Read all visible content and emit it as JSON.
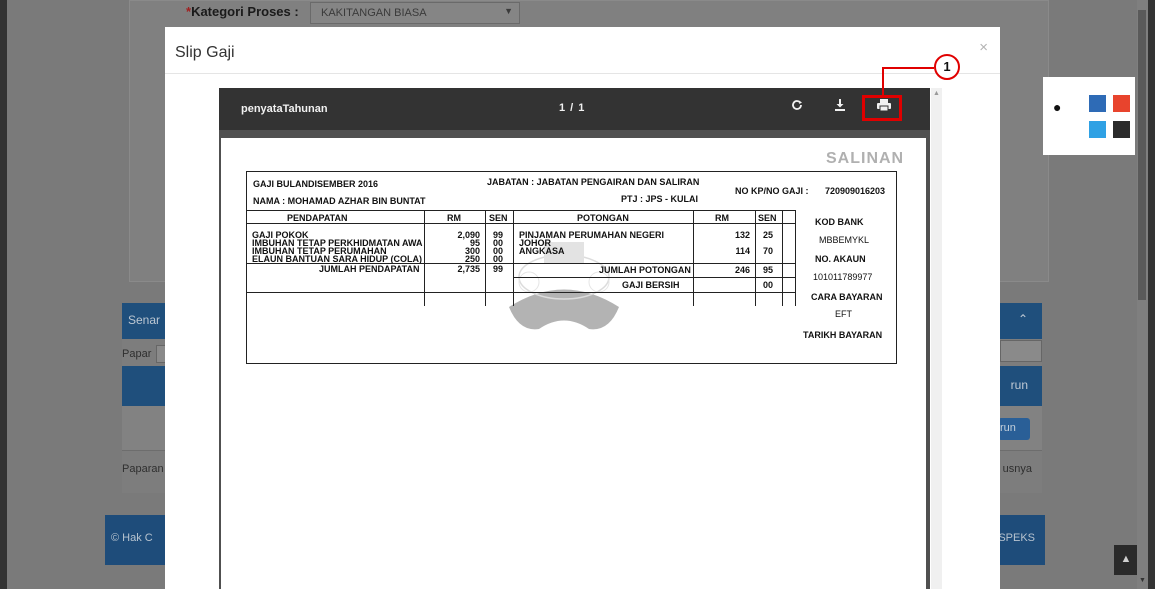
{
  "background": {
    "field_label": "Kategori Proses :",
    "field_required_mark": "*",
    "field_value": "KAKITANGAN BIASA",
    "panel_title": "Senar",
    "papar_label": "Papar",
    "table_action": "run",
    "row_button": "run",
    "paparan_label": "Paparan",
    "sunya_label": "usnya",
    "footer_left": "© Hak C",
    "footer_right": "e1SPEKS"
  },
  "theme_colors": [
    "#2e6bb6",
    "#e8442d",
    "#2fa1e4",
    "#2b2b2b"
  ],
  "modal": {
    "title": "Slip Gaji",
    "close": "×"
  },
  "viewer": {
    "doc_title": "penyataTahunan",
    "pages": "1 / 1",
    "rotate_icon": "rotate-icon",
    "download_icon": "download-icon",
    "print_icon": "print-icon"
  },
  "annotation": {
    "step": "1"
  },
  "payslip": {
    "watermark": "SALINAN",
    "gaji_bulan": "GAJI BULANDISEMBER 2016",
    "jabatan": "JABATAN : JABATAN PENGAIRAN DAN SALIRAN",
    "nama": "NAMA : MOHAMAD AZHAR BIN BUNTAT",
    "ptj": "PTJ : JPS - KULAI",
    "no_kp_label": "NO KP/NO GAJI :",
    "no_kp_value": "720909016203",
    "headers": {
      "pendapatan": "PENDAPATAN",
      "rm": "RM",
      "sen": "SEN",
      "potongan": "POTONGAN",
      "kod_bank": "KOD BANK"
    },
    "earnings": [
      {
        "name": "GAJI POKOK",
        "rm": "2,090",
        "sen": "99"
      },
      {
        "name": "IMBUHAN TETAP PERKHIDMATAN AWA",
        "rm": "95",
        "sen": "00"
      },
      {
        "name": "IMBUHAN TETAP PERUMAHAN",
        "rm": "300",
        "sen": "00"
      },
      {
        "name": "ELAUN BANTUAN SARA HIDUP (COLA)",
        "rm": "250",
        "sen": "00"
      }
    ],
    "jumlah_pendapatan_label": "JUMLAH PENDAPATAN",
    "jumlah_pendapatan_rm": "2,735",
    "jumlah_pendapatan_sen": "99",
    "deductions": [
      {
        "name": "PINJAMAN PERUMAHAN NEGERI",
        "rm": "132",
        "sen": "25"
      },
      {
        "name": "JOHOR",
        "rm": "",
        "sen": ""
      },
      {
        "name": "ANGKASA",
        "rm": "114",
        "sen": "70"
      }
    ],
    "jumlah_potongan_label": "JUMLAH POTONGAN",
    "jumlah_potongan_rm": "246",
    "jumlah_potongan_sen": "95",
    "gaji_bersih_label": "GAJI BERSIH",
    "gaji_bersih_sen": "00",
    "kod_bank_value": "MBBEMYKL",
    "no_akaun_label": "NO. AKAUN",
    "no_akaun_value": "101011789977",
    "cara_bayaran_label": "CARA BAYARAN",
    "cara_bayaran_value": "EFT",
    "tarikh_bayaran_label": "TARIKH BAYARAN"
  }
}
